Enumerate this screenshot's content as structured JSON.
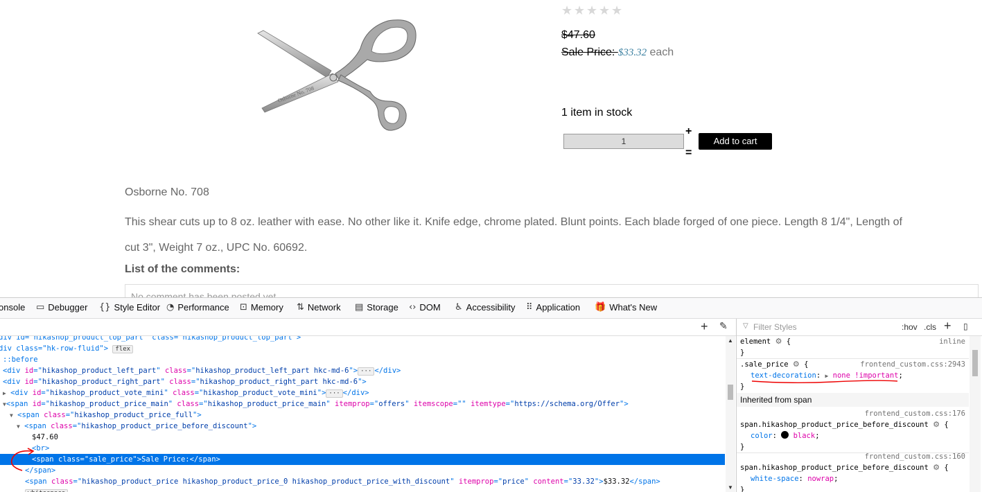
{
  "product": {
    "rating_stars": 5,
    "old_price": "$47.60",
    "sale_label": "Sale Price: ",
    "sale_value": "$33.32",
    "sale_suffix": " each",
    "stock": "1 item in stock",
    "quantity": "1",
    "qty_plus": "+",
    "qty_minus": "=",
    "add_to_cart": "Add to cart",
    "name": "Osborne No. 708",
    "image_engraving": "Osborne No. 708",
    "description": "This shear cuts up to 8 oz. leather with ease. No other like it. Knife edge, chrome plated. Blunt points. Each blade forged of one piece. Length 8 1/4\", Length of cut 3\", Weight 7 oz., UPC No. 60692.",
    "comments_title": "List of the comments:",
    "comments_empty": "No comment has been posted yet."
  },
  "devtools": {
    "tabs": [
      {
        "icon": "console-icon",
        "label": "onsole"
      },
      {
        "icon": "debugger-icon",
        "label": "Debugger"
      },
      {
        "icon": "style-editor-icon",
        "label": "Style Editor"
      },
      {
        "icon": "performance-icon",
        "label": "Performance"
      },
      {
        "icon": "memory-icon",
        "label": "Memory"
      },
      {
        "icon": "network-icon",
        "label": "Network"
      },
      {
        "icon": "storage-icon",
        "label": "Storage"
      },
      {
        "icon": "dom-icon",
        "label": "DOM"
      },
      {
        "icon": "accessibility-icon",
        "label": "Accessibility"
      },
      {
        "icon": "application-icon",
        "label": "Application"
      },
      {
        "icon": "whats-new-icon",
        "label": "What's New"
      }
    ],
    "filter_placeholder": "Filter Styles",
    "hov": ":hov",
    "cls": ".cls",
    "markup": {
      "l0": "div id=\"hikashop_product_top_part\" class=\"hikashop_product_top_part\">",
      "l1_tag": "div class=\"hk-row-fluid\">",
      "l1_badge": "flex",
      "l2": "::before",
      "l3_id": "hikashop_product_left_part",
      "l3_class": "hikashop_product_left_part hkc-md-6",
      "l4_id": "hikashop_product_right_part",
      "l4_class": "hikashop_product_right_part hkc-md-6",
      "l5_id": "hikashop_product_vote_mini",
      "l5_class": "hikashop_product_vote_mini",
      "l6_id": "hikashop_product_price_main",
      "l6_class": "hikashop_product_price_main",
      "l6_itemprop": "offers",
      "l6_itemscope": "",
      "l6_itemtype": "https://schema.org/Offer",
      "l7_class": "hikashop_product_price_full",
      "l8_class": "hikashop_product_price_before_discount",
      "l9_text": "$47.60",
      "l10_tag": "<br>",
      "l11_class": "sale_price",
      "l11_text": "Sale Price:",
      "l12_tag": "</span>",
      "l13_class": "hikashop_product_price hikashop_product_price_0 hikashop_product_price_with_discount",
      "l13_itemprop": "price",
      "l13_content": "33.32",
      "l13_text": "$33.32",
      "l14": "whitespace"
    },
    "rules": {
      "element_selector": "element",
      "inline": "inline",
      "sale_selector": ".sale_price",
      "sale_source": "frontend_custom.css:2943",
      "sale_prop": "text-decoration",
      "sale_value": "none !important",
      "inherited": "Inherited from span",
      "r1_source": "frontend_custom.css:176",
      "r1_selector": "span.hikashop_product_price_before_discount",
      "r1_prop": "color",
      "r1_value": "black",
      "r2_source": "frontend_custom.css:160",
      "r2_selector": "span.hikashop_product_price_before_discount",
      "r2_prop": "white-space",
      "r2_value": "nowrap"
    }
  }
}
